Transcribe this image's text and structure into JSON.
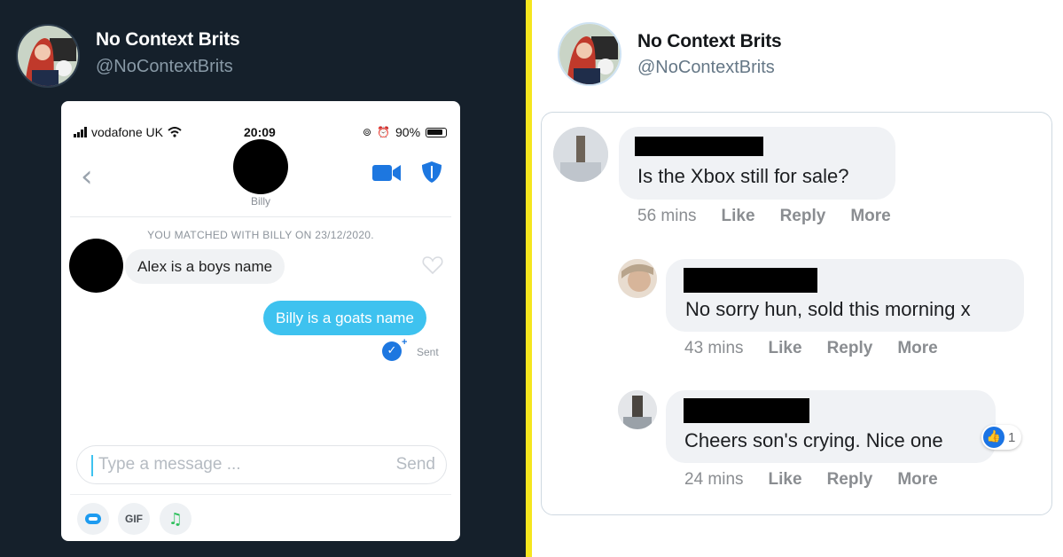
{
  "left_tweet": {
    "account_name": "No Context Brits",
    "account_handle": "@NoContextBrits"
  },
  "phone": {
    "status_bar": {
      "carrier": "vodafone UK",
      "time": "20:09",
      "battery": "90%"
    },
    "match_name": "Billy",
    "matched_note": "YOU MATCHED WITH BILLY ON 23/12/2020.",
    "messages": {
      "incoming": "Alex is a boys name",
      "outgoing": "Billy is a goats name",
      "sent_label": "Sent"
    },
    "composer": {
      "placeholder": "Type a message ...",
      "send_label": "Send"
    },
    "tools": {
      "gif_label": "GIF"
    },
    "colors": {
      "outgoing_bubble": "#3ec2ef",
      "verified_blue": "#1d77e0"
    }
  },
  "right_tweet": {
    "account_name": "No Context Brits",
    "account_handle": "@NoContextBrits"
  },
  "facebook_comments": [
    {
      "text": "Is the Xbox still for sale?",
      "time": "56 mins",
      "like_label": "Like",
      "reply_label": "Reply",
      "more_label": "More"
    },
    {
      "text": "No sorry hun, sold this morning x",
      "time": "43 mins",
      "like_label": "Like",
      "reply_label": "Reply",
      "more_label": "More"
    },
    {
      "text": "Cheers son's crying. Nice one",
      "time": "24 mins",
      "like_label": "Like",
      "reply_label": "Reply",
      "more_label": "More",
      "reaction_count": "1"
    }
  ],
  "colors": {
    "left_background": "#15202b",
    "divider": "#f5e61e",
    "right_background": "#ffffff",
    "fb_reaction_blue": "#1b74e4"
  }
}
